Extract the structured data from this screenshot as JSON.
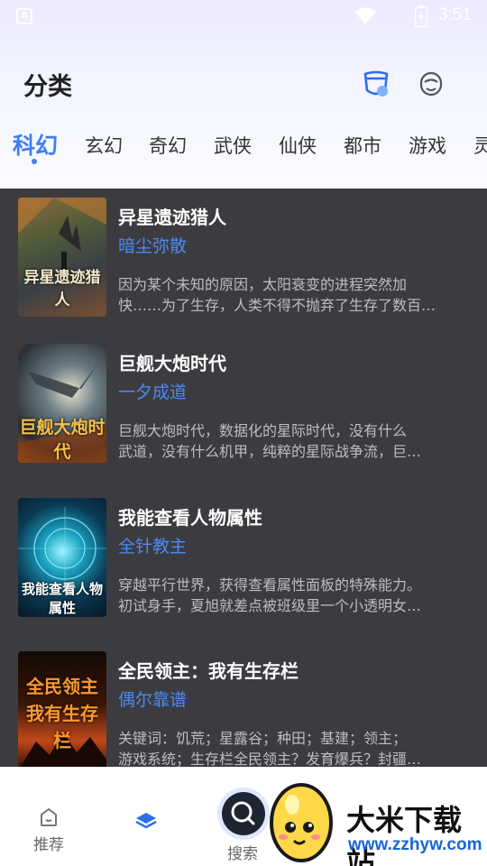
{
  "status": {
    "time": "3:51",
    "app_badge": "A"
  },
  "header": {
    "title": "分类"
  },
  "tabs": [
    {
      "label": "科幻"
    },
    {
      "label": "玄幻"
    },
    {
      "label": "奇幻"
    },
    {
      "label": "武侠"
    },
    {
      "label": "仙侠"
    },
    {
      "label": "都市"
    },
    {
      "label": "游戏"
    },
    {
      "label": "灵"
    }
  ],
  "books": [
    {
      "title": "异星遗迹猎人",
      "author": "暗尘弥散",
      "desc1": "因为某个未知的原因，太阳衰变的进程突然加",
      "desc2": "快……为了生存，人类不得不抛弃了生存了数百…",
      "cover_text": "异星遗迹猎人"
    },
    {
      "title": "巨舰大炮时代",
      "author": "一夕成道",
      "desc1": "巨舰大炮时代，数据化的星际时代，没有什么",
      "desc2": "武道，没有什么机甲，纯粹的星际战争流，巨…",
      "cover_text": "巨舰大炮时代"
    },
    {
      "title": "我能查看人物属性",
      "author": "全针教主",
      "desc1": "穿越平行世界，获得查看属性面板的特殊能力。",
      "desc2": "初试身手，夏旭就差点被班级里一个小透明女…",
      "cover_text": "我能查看人物属性"
    },
    {
      "title": "全民领主：我有生存栏",
      "author": "偶尔靠谱",
      "desc1": "关键词：饥荒；星露谷；种田；基建；领主；",
      "desc2": "游戏系统；生存栏全民领主？发育爆兵？封疆…",
      "cover_text": "全民领主我有生存栏"
    }
  ],
  "bottom_nav": {
    "recommend": "推荐",
    "search": "搜索"
  },
  "watermark": {
    "title": "大米下载站",
    "url": "www.zzhyw.com"
  },
  "colors": {
    "accent": "#3d7ef0",
    "author": "#4a8af4",
    "list_bg": "#3c3c40"
  }
}
